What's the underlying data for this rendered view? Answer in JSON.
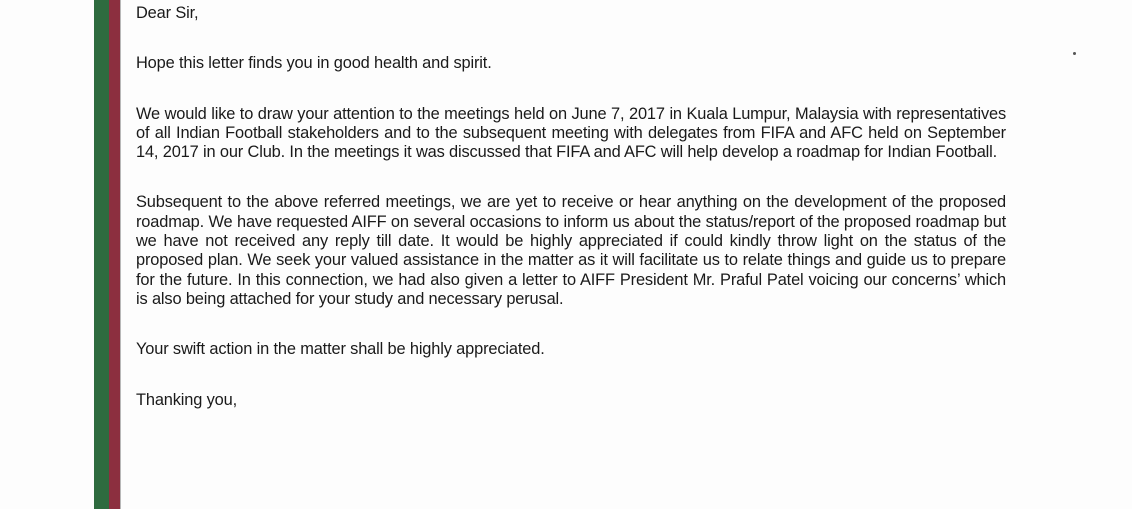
{
  "letter": {
    "salutation": "Dear Sir,",
    "paragraphs": [
      "Hope this letter finds you in good health and spirit.",
      "We would like to draw your attention to the meetings held on June 7, 2017 in Kuala Lumpur, Malaysia with representatives of all Indian Football stakeholders and to the subsequent meeting with delegates from FIFA and AFC held on September 14, 2017 in our Club. In the meetings it was discussed that FIFA and AFC will help develop a roadmap for Indian Football.",
      "Subsequent to the above referred meetings, we are yet to receive or hear anything on the development of the proposed roadmap. We have requested AIFF on several occasions to inform us about the status/report of the proposed roadmap but we have not received any reply till date.  It would be highly appreciated if could kindly throw light on the status of the proposed plan. We seek your valued assistance in the matter as it will facilitate us to relate things and guide us to prepare for the future. In this connection, we had also given a letter to AIFF President Mr. Praful Patel voicing our concerns’ which is also being attached for your study and necessary perusal.",
      "Your swift action in the matter shall be highly appreciated."
    ],
    "closing": "Thanking you,"
  },
  "colors": {
    "band_green": "#2e6b3f",
    "band_maroon": "#8c2f3f",
    "text": "#1a1a1a",
    "paper": "#fdfdfd"
  }
}
